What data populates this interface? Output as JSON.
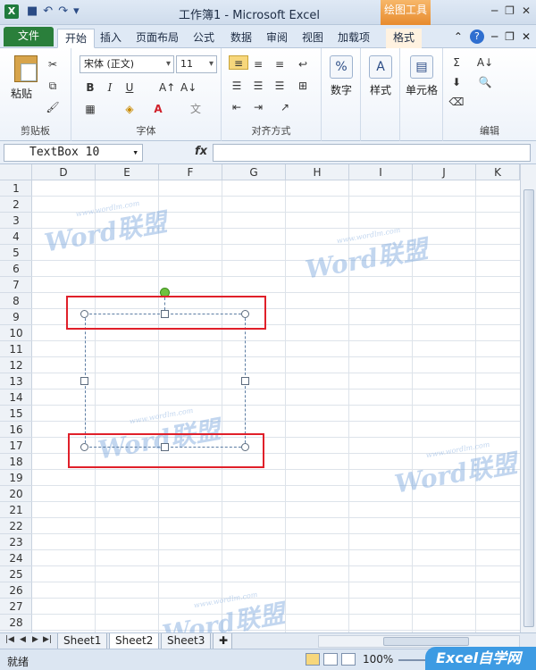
{
  "window": {
    "title": "工作簿1 - Microsoft Excel",
    "contextual_tab": "绘图工具",
    "app_icon": "excel-logo-icon"
  },
  "quick_access": [
    "save-icon",
    "undo-icon",
    "redo-icon",
    "customize-icon"
  ],
  "tabs": {
    "file": "文件",
    "items": [
      "开始",
      "插入",
      "页面布局",
      "公式",
      "数据",
      "审阅",
      "视图",
      "加载项",
      "格式"
    ],
    "active": "开始"
  },
  "ribbon": {
    "clipboard": {
      "paste": "粘贴",
      "label": "剪贴板"
    },
    "font": {
      "name": "宋体 (正文)",
      "size": "11",
      "bold": "B",
      "italic": "I",
      "underline": "U",
      "label": "字体"
    },
    "alignment": {
      "label": "对齐方式"
    },
    "number": {
      "button": "数字"
    },
    "styles": {
      "button": "样式"
    },
    "cells": {
      "button": "单元格"
    },
    "editing": {
      "label": "编辑"
    }
  },
  "formula_bar": {
    "name_box": "TextBox 10",
    "fx": "fx",
    "value": ""
  },
  "grid": {
    "columns": [
      "D",
      "E",
      "F",
      "G",
      "H",
      "I",
      "J",
      "K"
    ],
    "rows": [
      "1",
      "2",
      "3",
      "4",
      "5",
      "6",
      "7",
      "8",
      "9",
      "10",
      "11",
      "12",
      "13",
      "14",
      "15",
      "16",
      "17",
      "18",
      "19",
      "20",
      "21",
      "22",
      "23",
      "24",
      "25",
      "26",
      "27",
      "28"
    ]
  },
  "watermark": {
    "text": "Word联盟",
    "url": "www.wordlm.com"
  },
  "sheets": {
    "tabs": [
      "Sheet1",
      "Sheet2",
      "Sheet3"
    ],
    "active": "Sheet2"
  },
  "status": {
    "ready": "就绪",
    "zoom": "100%",
    "brand": "Excel自学网"
  }
}
